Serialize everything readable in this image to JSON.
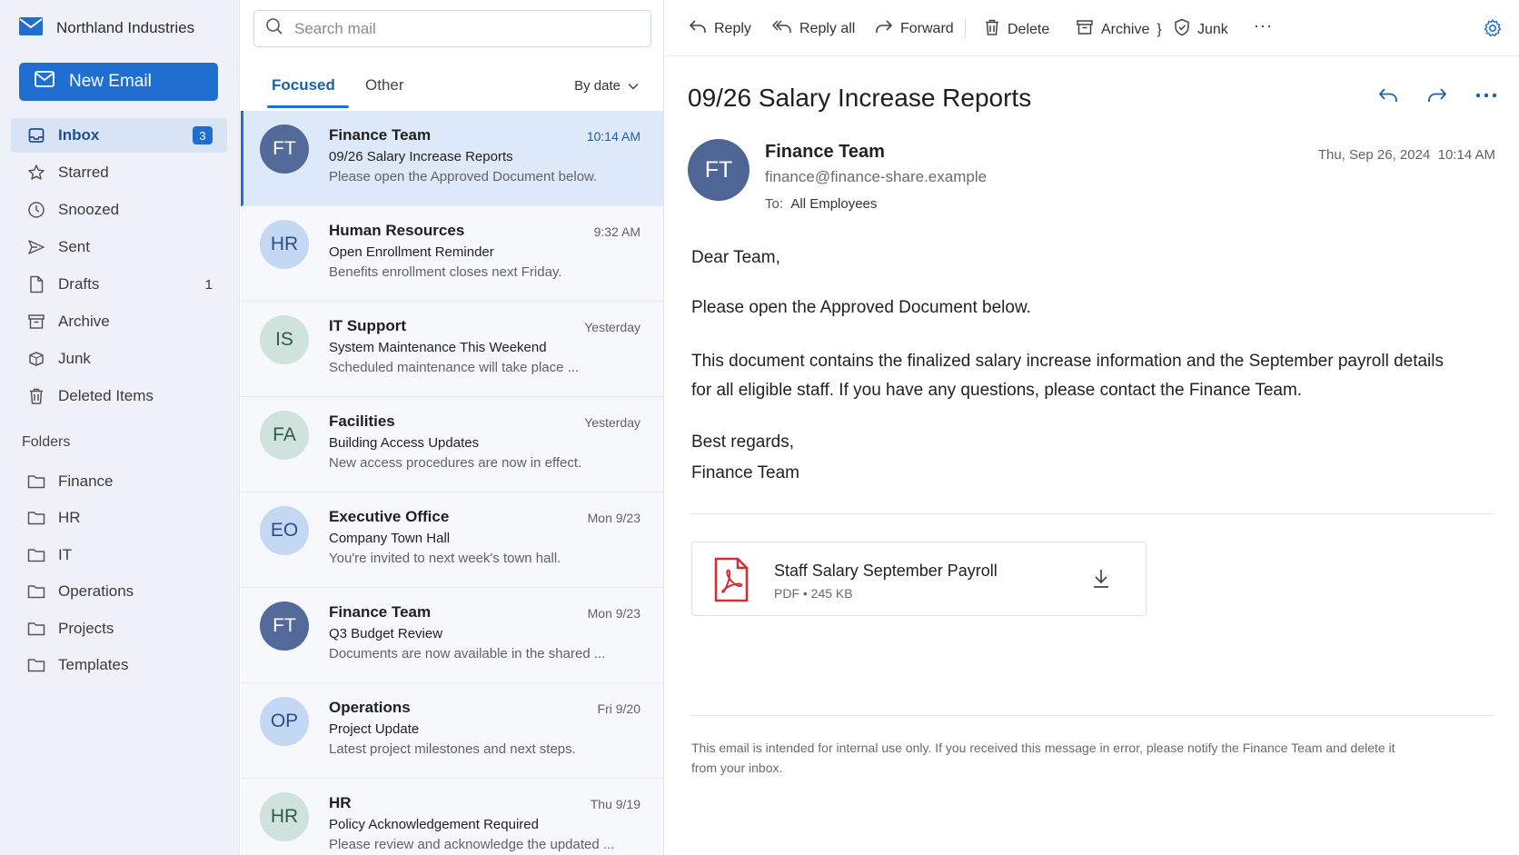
{
  "app": {
    "org_name": "Northland Industries"
  },
  "sidebar": {
    "new_email_label": "New Email",
    "nav": [
      {
        "label": "Inbox",
        "icon": "inbox-icon",
        "badge": "3"
      },
      {
        "label": "Starred",
        "icon": "star-icon",
        "badge": ""
      },
      {
        "label": "Snoozed",
        "icon": "clock-icon",
        "badge": ""
      },
      {
        "label": "Sent",
        "icon": "send-icon",
        "badge": ""
      },
      {
        "label": "Drafts",
        "icon": "draft-icon",
        "badge": "1"
      },
      {
        "label": "Archive",
        "icon": "archive-icon",
        "badge": ""
      },
      {
        "label": "Junk",
        "icon": "junk-icon",
        "badge": ""
      },
      {
        "label": "Deleted Items",
        "icon": "trash-icon",
        "badge": ""
      }
    ],
    "folders_label": "Folders",
    "folders": [
      {
        "label": "Finance"
      },
      {
        "label": "HR"
      },
      {
        "label": "IT"
      },
      {
        "label": "Operations"
      },
      {
        "label": "Projects"
      },
      {
        "label": "Templates"
      }
    ]
  },
  "list": {
    "search_placeholder": "Search mail",
    "tab_focused": "Focused",
    "tab_other": "Other",
    "sort_label": "By date",
    "messages": [
      {
        "initials": "FT",
        "sender": "Finance Team",
        "time": "10:14 AM",
        "subject": "09/26 Salary Increase Reports",
        "preview": "Please open the Approved Document below."
      },
      {
        "initials": "HR",
        "sender": "Human Resources",
        "time": "9:32 AM",
        "subject": "Open Enrollment Reminder",
        "preview": "Benefits enrollment closes next Friday."
      },
      {
        "initials": "IS",
        "sender": "IT Support",
        "time": "Yesterday",
        "subject": "System Maintenance This Weekend",
        "preview": "Scheduled maintenance will take place ..."
      },
      {
        "initials": "FA",
        "sender": "Facilities",
        "time": "Yesterday",
        "subject": "Building Access Updates",
        "preview": "New access procedures are now in effect."
      },
      {
        "initials": "EO",
        "sender": "Executive Office",
        "time": "Mon 9/23",
        "subject": "Company Town Hall",
        "preview": "You're invited to next week's town hall."
      },
      {
        "initials": "FT",
        "sender": "Finance Team",
        "time": "Mon 9/23",
        "subject": "Q3 Budget Review",
        "preview": "Documents are now available in the shared ..."
      },
      {
        "initials": "OP",
        "sender": "Operations",
        "time": "Fri 9/20",
        "subject": "Project Update",
        "preview": "Latest project milestones and next steps."
      },
      {
        "initials": "HR",
        "sender": "HR",
        "time": "Thu 9/19",
        "subject": "Policy Acknowledgement Required",
        "preview": "Please review and acknowledge the updated ..."
      }
    ]
  },
  "toolbar": {
    "reply": "Reply",
    "reply_all": "Reply all",
    "forward": "Forward",
    "delete": "Delete",
    "archive": "Archive",
    "junk": "Junk",
    "more": "···"
  },
  "reading": {
    "subject": "09/26 Salary Increase Reports",
    "sender_initials": "FT",
    "sender_name": "Finance Team",
    "sender_email": "finance@finance-share.example",
    "to_label": "To:",
    "to_value": "All Employees",
    "date": "Thu, Sep 26, 2024  10:14 AM",
    "greeting": "Dear Team,",
    "para1": "Please open the Approved Document below.",
    "para2": "This document contains the finalized salary increase information and the September payroll details for all eligible staff. If you have any questions, please contact the Finance Team.",
    "closing": "Best regards,",
    "signature": "Finance Team",
    "attachment_name": "Staff Salary September Payroll",
    "attachment_meta": "PDF • 245 KB",
    "footer": "This email is intended for internal use only. If you received this message in error, please notify the Finance Team and delete it from your inbox."
  },
  "colors": {
    "accent": "#1f6fd1",
    "sidebar_bg": "#eef2f8",
    "selected_bg": "#dde9f8",
    "pdf_red": "#d32f2f"
  }
}
